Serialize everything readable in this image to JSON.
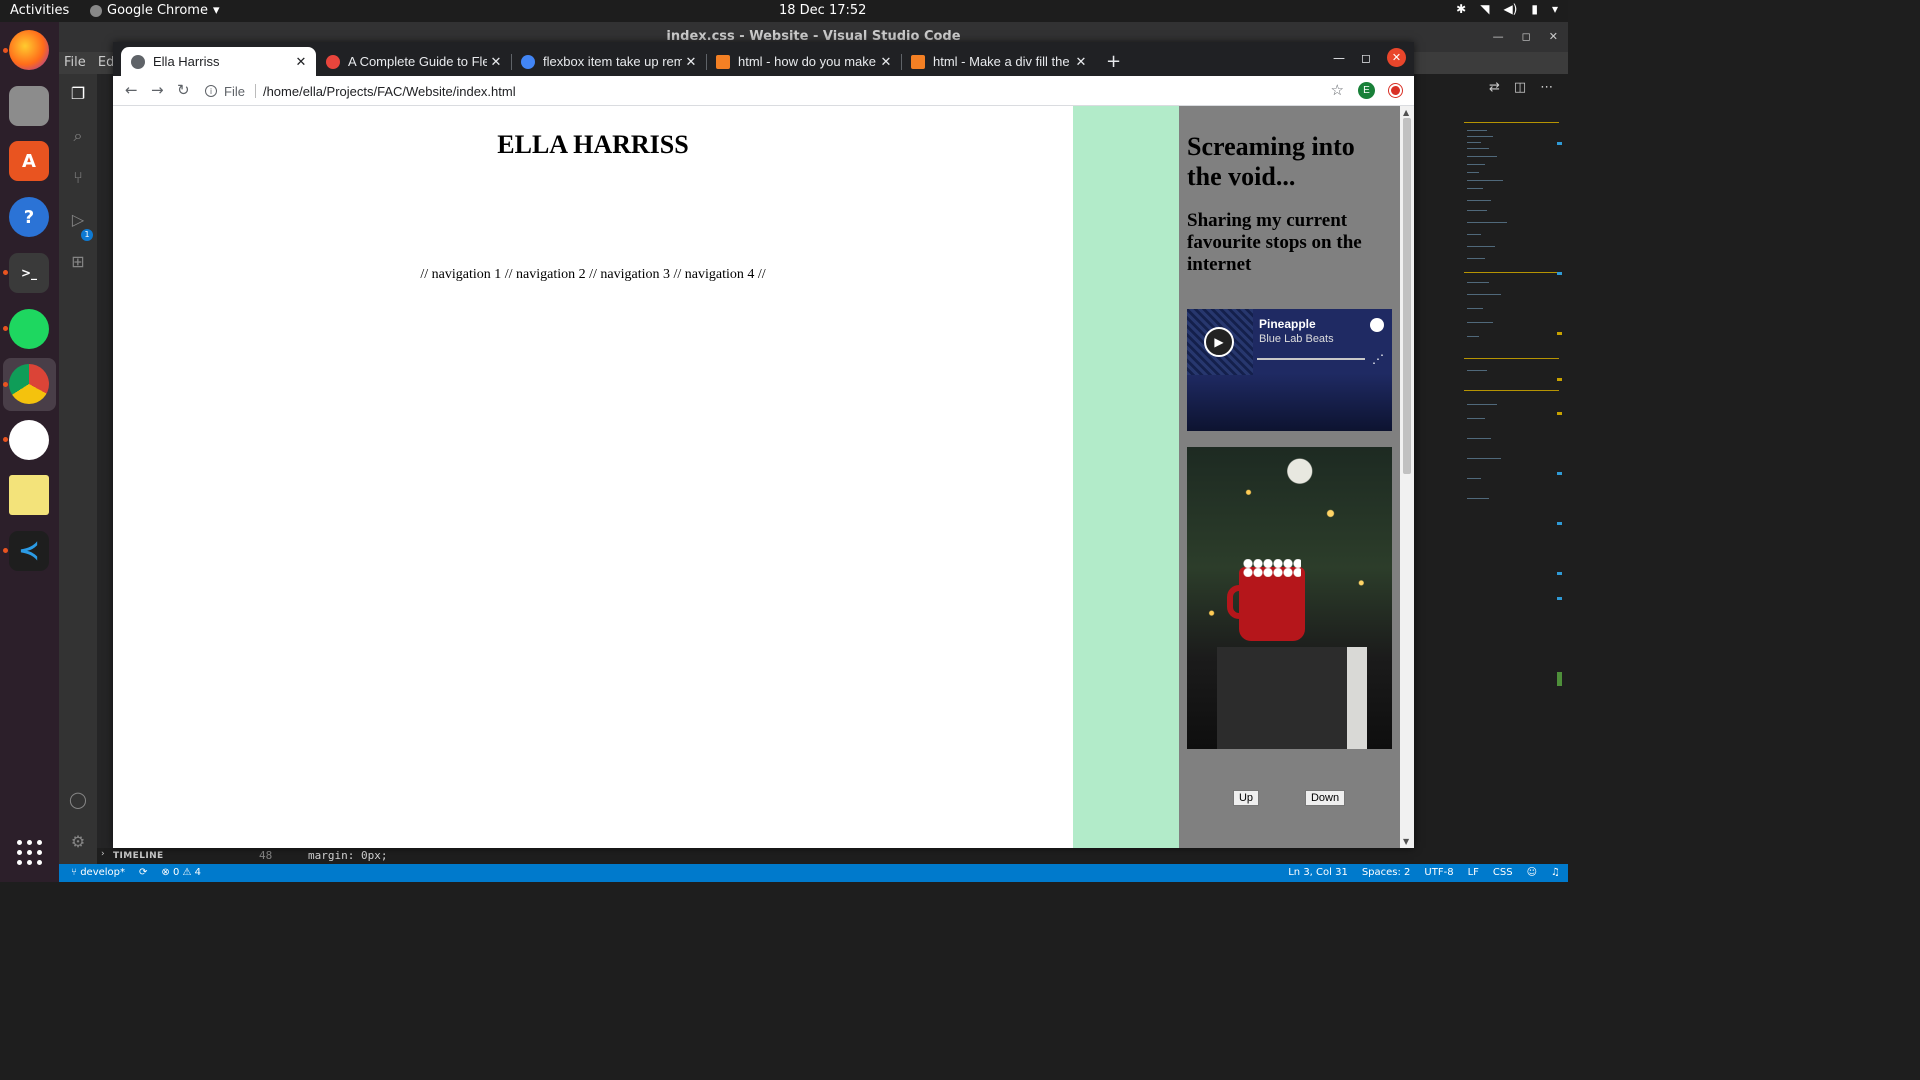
{
  "topbar": {
    "activities": "Activities",
    "app_name": "Google Chrome",
    "clock": "18 Dec  17:52"
  },
  "dock": {
    "apps": [
      "Firefox",
      "Files",
      "Ubuntu Software",
      "Help",
      "Terminal",
      "Spotify",
      "Google Chrome",
      "Slack",
      "Notes",
      "Visual Studio Code"
    ],
    "show_apps_icon": "grid-icon"
  },
  "vscode": {
    "title": "index.css - Website - Visual Studio Code",
    "menu": [
      "File",
      "Edi"
    ],
    "timeline_label": "TIMELINE",
    "line_number": "48",
    "code_line": "margin: 0px;",
    "source_control_badge": "1",
    "status": {
      "branch": "develop*",
      "errors": "0",
      "warnings": "4",
      "cursor": "Ln 3, Col 31",
      "spaces": "Spaces: 2",
      "encoding": "UTF-8",
      "eol": "LF",
      "language": "CSS"
    }
  },
  "chrome": {
    "tabs": [
      {
        "title": "Ella Harriss",
        "active": true,
        "favicon_color": "#5f6368"
      },
      {
        "title": "A Complete Guide to Flexbox",
        "active": false,
        "favicon_color": "#e8453c"
      },
      {
        "title": "flexbox item take up remaining",
        "active": false,
        "favicon_color": "#4285f4"
      },
      {
        "title": "html - how do you make a div",
        "active": false,
        "favicon_color": "#f48024"
      },
      {
        "title": "html - Make a div fill the height",
        "active": false,
        "favicon_color": "#f48024"
      }
    ],
    "address": {
      "scheme": "File",
      "url": "/home/ella/Projects/FAC/Website/index.html"
    },
    "profile_initial": "E"
  },
  "page": {
    "title": "ELLA HARRISS",
    "nav": "// navigation 1 // navigation 2 // navigation 3 // navigation 4 //",
    "aside": {
      "heading": "Screaming into the void...",
      "subheading": "Sharing my current favourite stops on the internet",
      "spotify": {
        "track": "Pineapple",
        "artist": "Blue Lab Beats"
      },
      "buttons": {
        "up": "Up",
        "down": "Down"
      }
    },
    "colors": {
      "mint_column": "#b2ebc9",
      "aside_background": "#808080"
    }
  }
}
